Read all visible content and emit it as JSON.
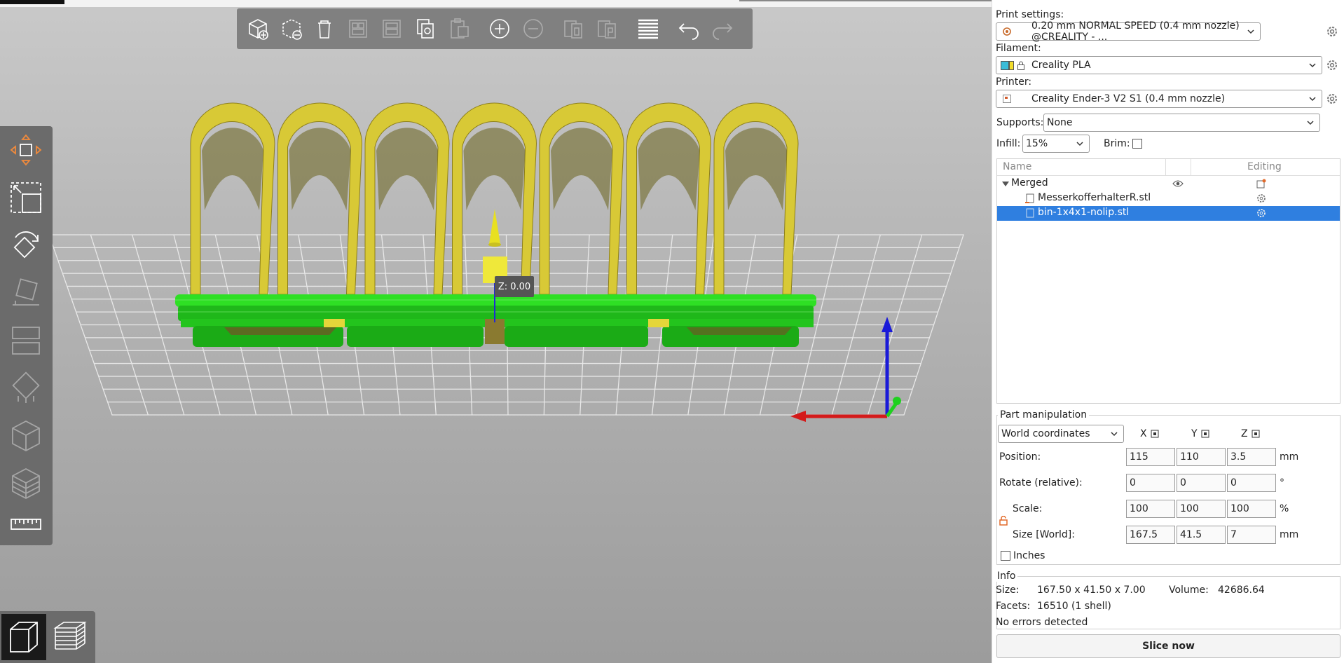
{
  "viewport": {
    "z_tooltip": "Z: 0.00",
    "toolbar_icons": [
      "add-icon",
      "delete-icon",
      "delete-all-icon",
      "arrange-icon",
      "arrange-selection-icon",
      "copy-icon",
      "paste-icon",
      "add-instance-icon",
      "remove-instance-icon",
      "split-objects-icon",
      "split-parts-icon",
      "layers-icon",
      "undo-icon",
      "redo-icon"
    ],
    "left_tools": [
      "move-icon",
      "scale-icon",
      "rotate-icon",
      "place-on-face-icon",
      "cut-icon",
      "paint-supports-icon",
      "seam-painting-icon",
      "multimaterial-icon",
      "measure-icon"
    ],
    "view_toggle": [
      "3d-view-icon",
      "preview-icon"
    ],
    "colors": {
      "model_green": "#22c41c",
      "model_yellow": "#e5d63a",
      "toolbar_bg": "#808080"
    }
  },
  "sidebar": {
    "print_settings_label": "Print settings:",
    "print_settings_value": "0.20 mm NORMAL SPEED (0.4 mm nozzle) @CREALITY - ...",
    "filament_label": "Filament:",
    "filament_value": "Creality PLA",
    "printer_label": "Printer:",
    "printer_value": "Creality Ender-3 V2 S1 (0.4 mm nozzle)",
    "supports_label": "Supports:",
    "supports_value": "None",
    "infill_label": "Infill:",
    "infill_value": "15%",
    "brim_label": "Brim:",
    "objects": {
      "col_name": "Name",
      "col_editing": "Editing",
      "rows": [
        {
          "name": "Merged",
          "selected": false
        },
        {
          "name": "MesserkofferhalterR.stl",
          "selected": false
        },
        {
          "name": "bin-1x4x1-nolip.stl",
          "selected": true
        }
      ]
    },
    "part": {
      "title": "Part manipulation",
      "coords": "World coordinates",
      "x_label": "X",
      "y_label": "Y",
      "z_label": "Z",
      "position_label": "Position:",
      "position": [
        "115",
        "110",
        "3.5"
      ],
      "position_unit": "mm",
      "rotate_label": "Rotate (relative):",
      "rotate": [
        "0",
        "0",
        "0"
      ],
      "rotate_unit": "°",
      "scale_label": "Scale:",
      "scale": [
        "100",
        "100",
        "100"
      ],
      "scale_unit": "%",
      "size_label": "Size [World]:",
      "size": [
        "167.5",
        "41.5",
        "7"
      ],
      "size_unit": "mm",
      "inches_label": "Inches"
    },
    "info": {
      "title": "Info",
      "size_label": "Size:",
      "size_value": "167.50 x 41.50 x 7.00",
      "volume_label": "Volume:",
      "volume_value": "42686.64",
      "facets_label": "Facets:",
      "facets_value": "16510 (1 shell)",
      "status": "No errors detected"
    },
    "slice_button": "Slice now"
  }
}
